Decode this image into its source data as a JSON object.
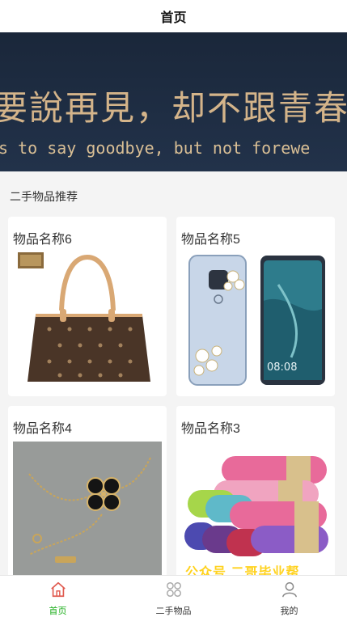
{
  "navbar": {
    "title": "首页"
  },
  "banner": {
    "line1": "要說再見，却不跟青春",
    "line2": "s to say goodbye, but not forewe"
  },
  "section": {
    "title": "二手物品推荐"
  },
  "items": [
    {
      "name": "物品名称6",
      "image": "handbag-photo"
    },
    {
      "name": "物品名称5",
      "image": "phone-case-photo"
    },
    {
      "name": "物品名称4",
      "image": "necklace-photo"
    },
    {
      "name": "物品名称3",
      "image": "yoga-mats-photo"
    }
  ],
  "watermark": {
    "text": "公众号 二哥毕业帮"
  },
  "tabbar": {
    "tabs": [
      {
        "label": "首页",
        "icon": "home-icon",
        "active": true
      },
      {
        "label": "二手物品",
        "icon": "grid-icon",
        "active": false
      },
      {
        "label": "我的",
        "icon": "user-icon",
        "active": false
      }
    ]
  },
  "colors": {
    "accent": "#1aad19",
    "home_icon": "#e05a4f",
    "watermark": "#ffd21e",
    "banner_bg": "#1d2b40",
    "banner_text": "#d4b48a"
  }
}
